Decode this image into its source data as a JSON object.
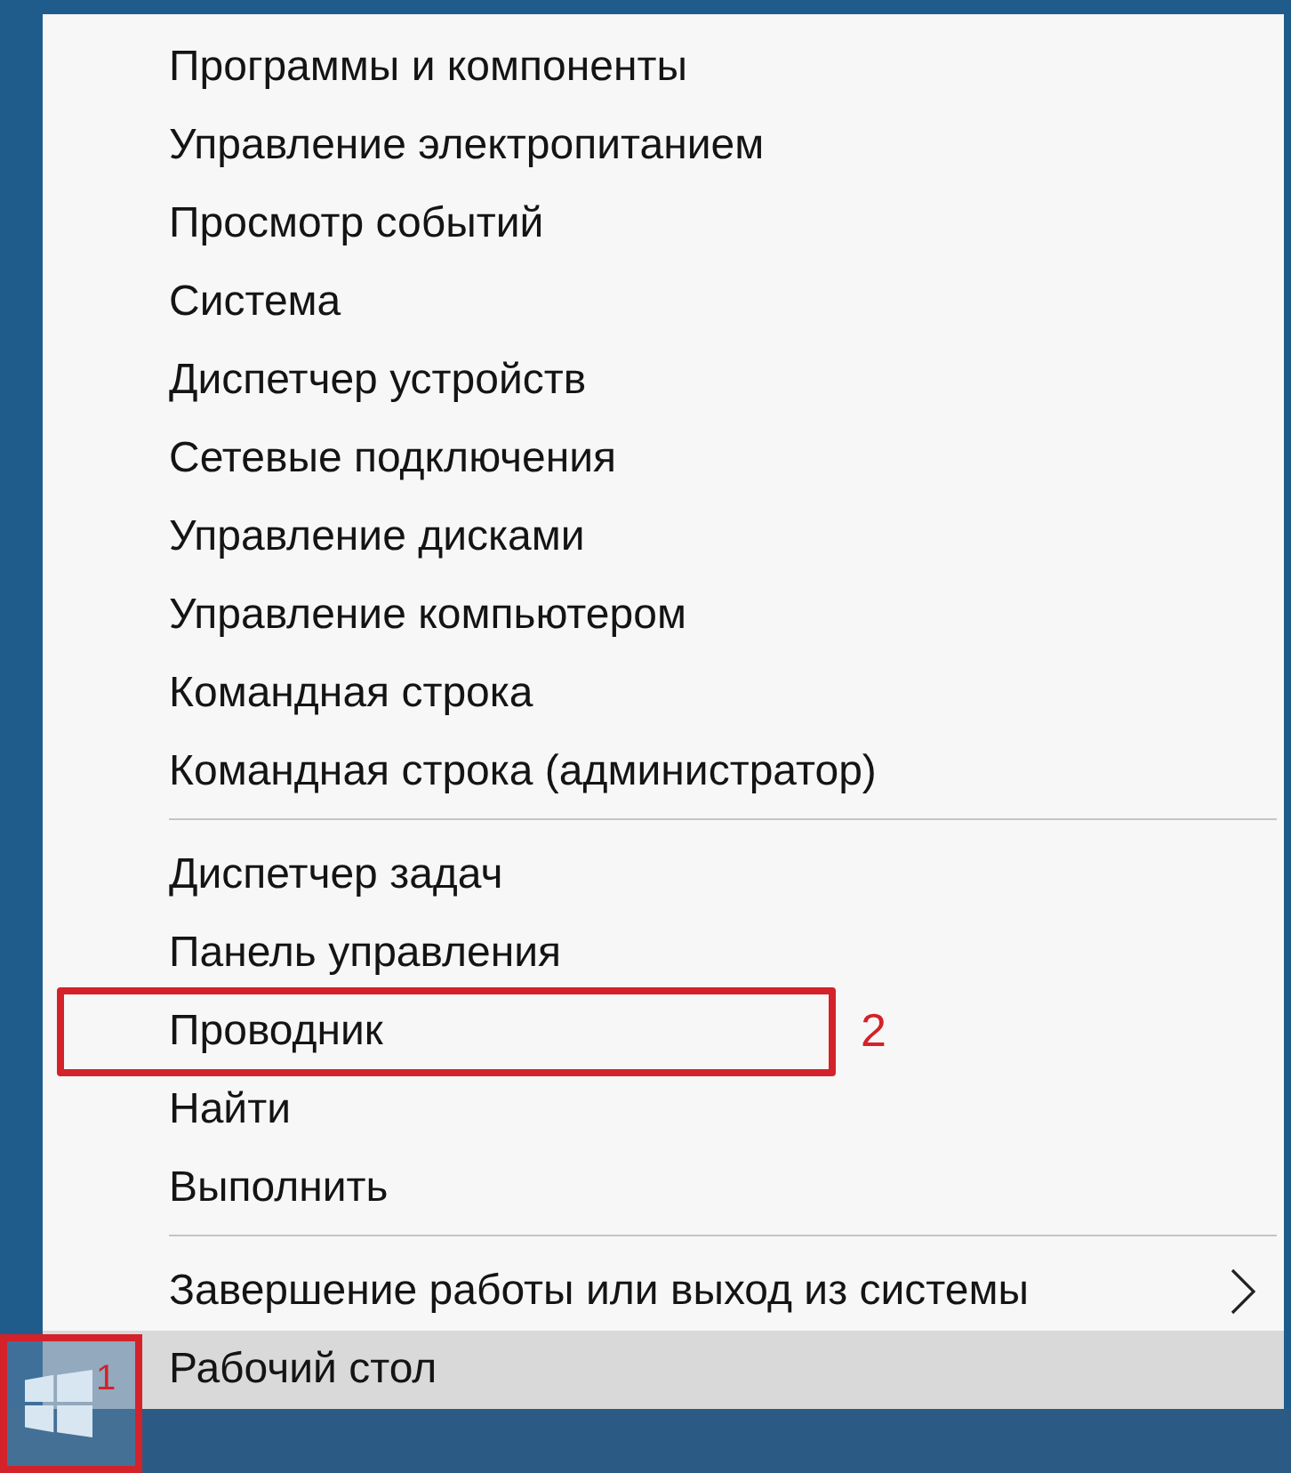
{
  "menu": {
    "groups": [
      {
        "items": [
          {
            "label": "Программы и компоненты",
            "kind": "plain",
            "selected": false
          },
          {
            "label": "Управление электропитанием",
            "kind": "plain",
            "selected": false
          },
          {
            "label": "Просмотр событий",
            "kind": "plain",
            "selected": false
          },
          {
            "label": "Система",
            "kind": "plain",
            "selected": false
          },
          {
            "label": "Диспетчер устройств",
            "kind": "plain",
            "selected": false
          },
          {
            "label": "Сетевые подключения",
            "kind": "plain",
            "selected": false
          },
          {
            "label": "Управление дисками",
            "kind": "plain",
            "selected": false
          },
          {
            "label": "Управление компьютером",
            "kind": "plain",
            "selected": false
          },
          {
            "label": "Командная строка",
            "kind": "plain",
            "selected": false
          },
          {
            "label": "Командная строка (администратор)",
            "kind": "plain",
            "selected": false
          }
        ]
      },
      {
        "items": [
          {
            "label": "Диспетчер задач",
            "kind": "plain",
            "selected": false
          },
          {
            "label": "Панель управления",
            "kind": "plain",
            "selected": false
          },
          {
            "label": "Проводник",
            "kind": "plain",
            "selected": false,
            "callout": "2"
          },
          {
            "label": "Найти",
            "kind": "plain",
            "selected": false
          },
          {
            "label": "Выполнить",
            "kind": "plain",
            "selected": false
          }
        ]
      },
      {
        "items": [
          {
            "label": "Завершение работы или выход из системы",
            "kind": "submenu",
            "selected": false
          },
          {
            "label": "Рабочий стол",
            "kind": "plain",
            "selected": true
          }
        ]
      }
    ]
  },
  "start_button": {
    "callout": "1"
  }
}
